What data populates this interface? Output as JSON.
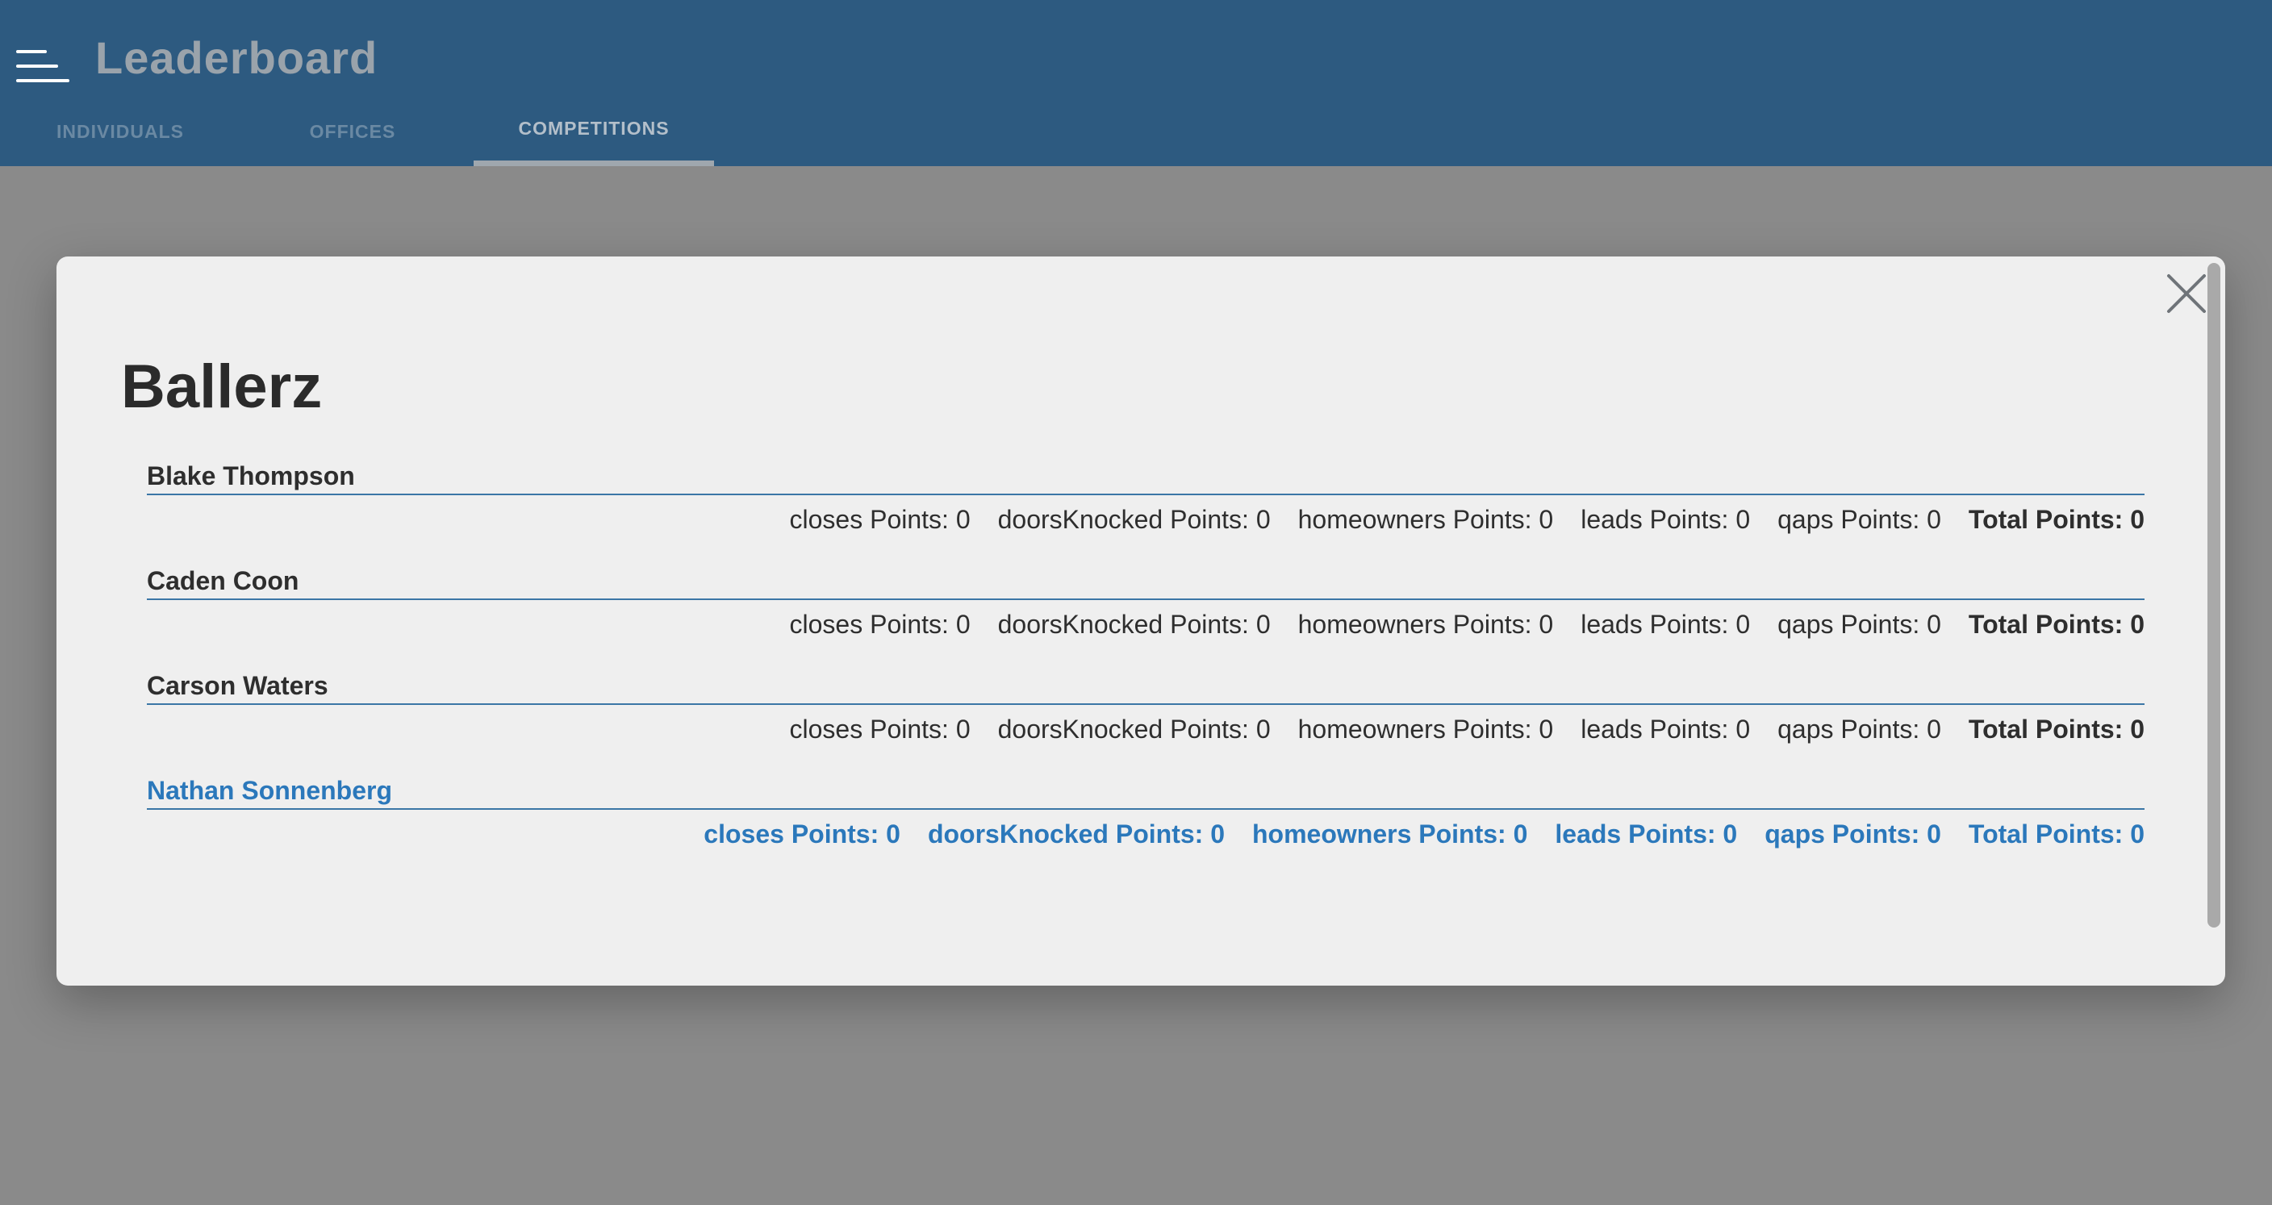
{
  "header": {
    "title": "Leaderboard",
    "menu_icon": "hamburger-menu-icon",
    "tabs": [
      {
        "label": "INDIVIDUALS",
        "active": false
      },
      {
        "label": "OFFICES",
        "active": false
      },
      {
        "label": "COMPETITIONS",
        "active": true
      }
    ]
  },
  "modal": {
    "close_icon": "close-icon",
    "team_name": "Ballerz",
    "members": [
      {
        "name": "Blake Thompson",
        "closes": "closes Points: 0",
        "doors": "doorsKnocked Points: 0",
        "homeowners": "homeowners Points: 0",
        "leads": "leads Points: 0",
        "qaps": "qaps Points: 0",
        "total": "Total Points: 0"
      },
      {
        "name": "Caden Coon",
        "closes": "closes Points: 0",
        "doors": "doorsKnocked Points: 0",
        "homeowners": "homeowners Points: 0",
        "leads": "leads Points: 0",
        "qaps": "qaps Points: 0",
        "total": "Total Points: 0"
      },
      {
        "name": "Carson Waters",
        "closes": "closes Points: 0",
        "doors": "doorsKnocked Points: 0",
        "homeowners": "homeowners Points: 0",
        "leads": "leads Points: 0",
        "qaps": "qaps Points: 0",
        "total": "Total Points: 0"
      },
      {
        "name": "Nathan Sonnenberg",
        "highlighted": true,
        "closes": "closes Points: 0",
        "doors": "doorsKnocked Points: 0",
        "homeowners": "homeowners Points: 0",
        "leads": "leads Points: 0",
        "qaps": "qaps Points: 0",
        "total": "Total Points: 0"
      }
    ]
  },
  "colors": {
    "header_bg": "#2d5a80",
    "overlay": "#8a8a8a",
    "modal_bg": "#efefef",
    "divider": "#3b76a6",
    "highlight": "#2b78bb"
  }
}
